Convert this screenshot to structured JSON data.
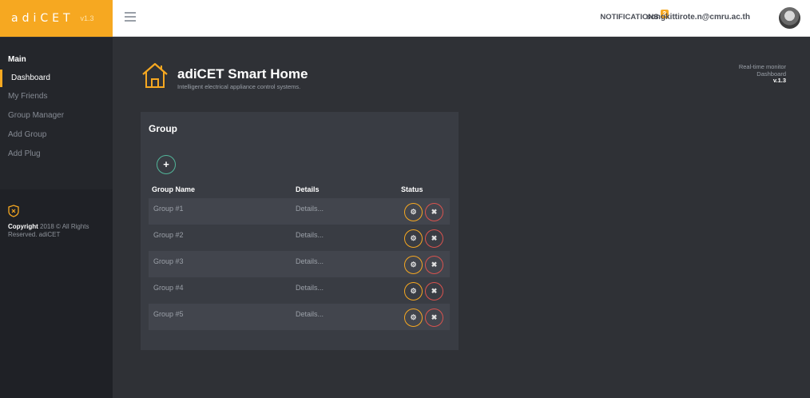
{
  "brand": {
    "name": "adiCET",
    "version": "v1.3"
  },
  "topbar": {
    "notifications_label": "NOTIFICATIONS",
    "notifications_count": "2",
    "user_email": "songkittirote.n@cmru.ac.th"
  },
  "sidebar": {
    "section": "Main",
    "items": [
      {
        "label": "Dashboard",
        "active": true
      },
      {
        "label": "My Friends"
      },
      {
        "label": "Group Manager"
      },
      {
        "label": "Add Group"
      },
      {
        "label": "Add Plug"
      }
    ],
    "copyright_bold": "Copyright",
    "copyright_rest": " 2018 © All Rights Reserved. adiCET"
  },
  "header": {
    "title": "adiCET Smart Home",
    "subtitle": "Intelligent electrical appliance control systems."
  },
  "status_info": {
    "line1": "Real-time monitor",
    "line2": "Dashboard",
    "version": "v.1.3"
  },
  "group_panel": {
    "title": "Group",
    "add_icon": "+",
    "columns": [
      "Group Name",
      "Details",
      "Status"
    ],
    "rows": [
      {
        "name": "Group #1",
        "details": "Details..."
      },
      {
        "name": "Group #2",
        "details": "Details..."
      },
      {
        "name": "Group #3",
        "details": "Details..."
      },
      {
        "name": "Group #4",
        "details": "Details..."
      },
      {
        "name": "Group #5",
        "details": "Details..."
      }
    ],
    "settings_icon": "⚙",
    "delete_icon": "✖"
  },
  "colors": {
    "accent": "#f6a821",
    "danger": "#d9534f",
    "success": "#52b69a",
    "panel": "#393c43"
  }
}
